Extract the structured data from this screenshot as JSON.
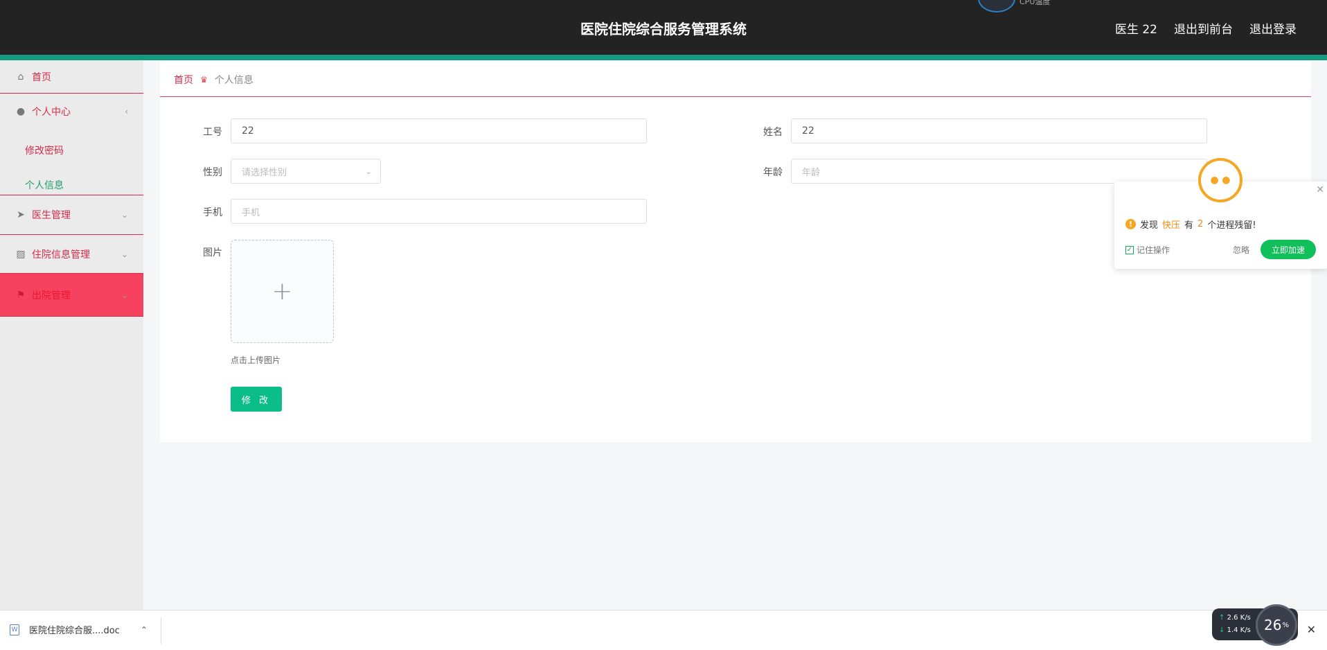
{
  "header": {
    "title": "医院住院综合服务管理系统",
    "user": "医生 22",
    "back_to_front": "退出到前台",
    "logout": "退出登录",
    "cpu_label": "CPU温度"
  },
  "sidebar": {
    "items": [
      {
        "label": "首页",
        "icon": "home-icon"
      },
      {
        "label": "个人中心",
        "icon": "user-icon",
        "chevron": "‹"
      },
      {
        "label": "医生管理",
        "icon": "send-icon",
        "chevron": "⌄"
      },
      {
        "label": "住院信息管理",
        "icon": "chart-icon",
        "chevron": "⌄"
      },
      {
        "label": "出院管理",
        "icon": "flag-icon",
        "chevron": "⌄"
      }
    ],
    "subitems": [
      {
        "label": "修改密码"
      },
      {
        "label": "个人信息"
      }
    ]
  },
  "breadcrumb": {
    "home": "首页",
    "current": "个人信息"
  },
  "form": {
    "employee_id_label": "工号",
    "employee_id_value": "22",
    "name_label": "姓名",
    "name_value": "22",
    "gender_label": "性别",
    "gender_placeholder": "请选择性别",
    "age_label": "年龄",
    "age_placeholder": "年龄",
    "phone_label": "手机",
    "phone_placeholder": "手机",
    "image_label": "图片",
    "upload_tip": "点击上传图片",
    "submit_label": "修 改"
  },
  "popup": {
    "msg_prefix": "发现",
    "app_name": "快压",
    "msg_mid": "有",
    "count": "2",
    "msg_suffix": "个进程残留!",
    "remember_label": "记住操作",
    "ignore_label": "忽略",
    "speed_label": "立即加速"
  },
  "download_bar": {
    "file_name": "医院住院综合服....doc"
  },
  "network_widget": {
    "up": "2.6",
    "down": "1.4",
    "unit": "K/s",
    "percent": "26",
    "percent_sign": "%"
  },
  "colors": {
    "header_bg": "#232323",
    "header_accent": "#159a82",
    "menu_text": "#d72a4a",
    "menu_active_bg": "#f7425f",
    "button_green": "#0bbd87"
  }
}
